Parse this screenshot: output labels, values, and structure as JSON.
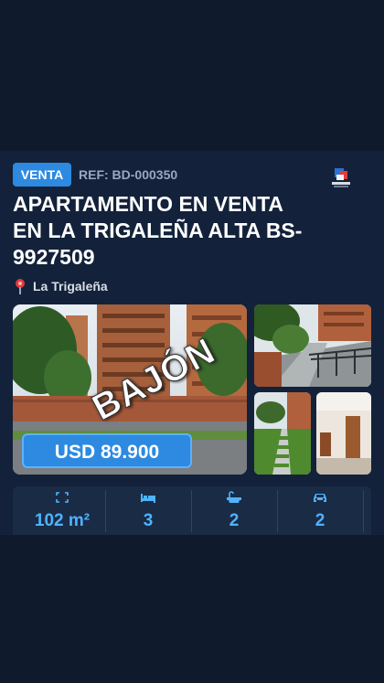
{
  "listing": {
    "type_badge": "VENTA",
    "ref": "REF: BD-000350",
    "title": "APARTAMENTO EN VENTA EN LA TRIGALEÑA ALTA BS-9927509",
    "location": "La Trigaleña",
    "stamp": "BAJÓN",
    "price": "USD 89.900"
  },
  "features": [
    {
      "icon": "area-icon",
      "value": "102 m²"
    },
    {
      "icon": "bed-icon",
      "value": "3"
    },
    {
      "icon": "bathtub-icon",
      "value": "2"
    },
    {
      "icon": "car-icon",
      "value": "2"
    }
  ],
  "colors": {
    "background": "#0f1b2c",
    "card": "#13223a",
    "accent": "#2d8ae0",
    "feature_value": "#4fb3ff"
  }
}
